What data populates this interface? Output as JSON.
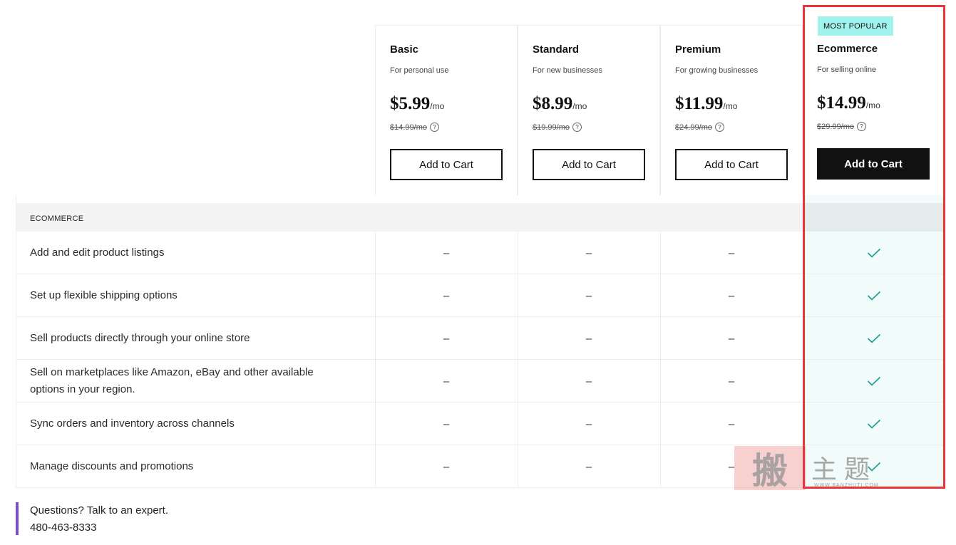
{
  "plans": [
    {
      "name": "Basic",
      "subtitle": "For personal use",
      "price": "$5.99",
      "per": "/mo",
      "old_price": "$14.99/mo",
      "button": "Add to Cart"
    },
    {
      "name": "Standard",
      "subtitle": "For new businesses",
      "price": "$8.99",
      "per": "/mo",
      "old_price": "$19.99/mo",
      "button": "Add to Cart"
    },
    {
      "name": "Premium",
      "subtitle": "For growing businesses",
      "price": "$11.99",
      "per": "/mo",
      "old_price": "$24.99/mo",
      "button": "Add to Cart"
    },
    {
      "name": "Ecommerce",
      "subtitle": "For selling online",
      "price": "$14.99",
      "per": "/mo",
      "old_price": "$29.99/mo",
      "button": "Add to Cart",
      "badge": "MOST POPULAR"
    }
  ],
  "section": {
    "title": "ECOMMERCE"
  },
  "features": [
    {
      "label": "Add and edit product listings",
      "values": [
        "–",
        "–",
        "–",
        "check"
      ]
    },
    {
      "label": "Set up flexible shipping options",
      "values": [
        "–",
        "–",
        "–",
        "check"
      ]
    },
    {
      "label": "Sell products directly through your online store",
      "values": [
        "–",
        "–",
        "–",
        "check"
      ]
    },
    {
      "label": "Sell on marketplaces like Amazon, eBay and other available options in your region.",
      "values": [
        "–",
        "–",
        "–",
        "check"
      ]
    },
    {
      "label": "Sync orders and inventory across channels",
      "values": [
        "–",
        "–",
        "–",
        "check"
      ]
    },
    {
      "label": "Manage discounts and promotions",
      "values": [
        "–",
        "–",
        "–",
        "check"
      ]
    }
  ],
  "icons": {
    "help": "help-circle-icon",
    "check": "checkmark-icon"
  },
  "help_glyph": "?",
  "contact": {
    "question": "Questions? Talk to an expert.",
    "phone": "480-463-8333"
  },
  "watermark": {
    "stamp": "搬",
    "text": "主题",
    "url": "WWW.BANZHUTI.COM"
  },
  "colors": {
    "accent_check": "#1b9c94",
    "badge_bg": "#9ff3ec",
    "highlight_border": "#e8343a",
    "featured_bg": "#f1fbfa",
    "contact_bar": "#7b4fc4"
  }
}
